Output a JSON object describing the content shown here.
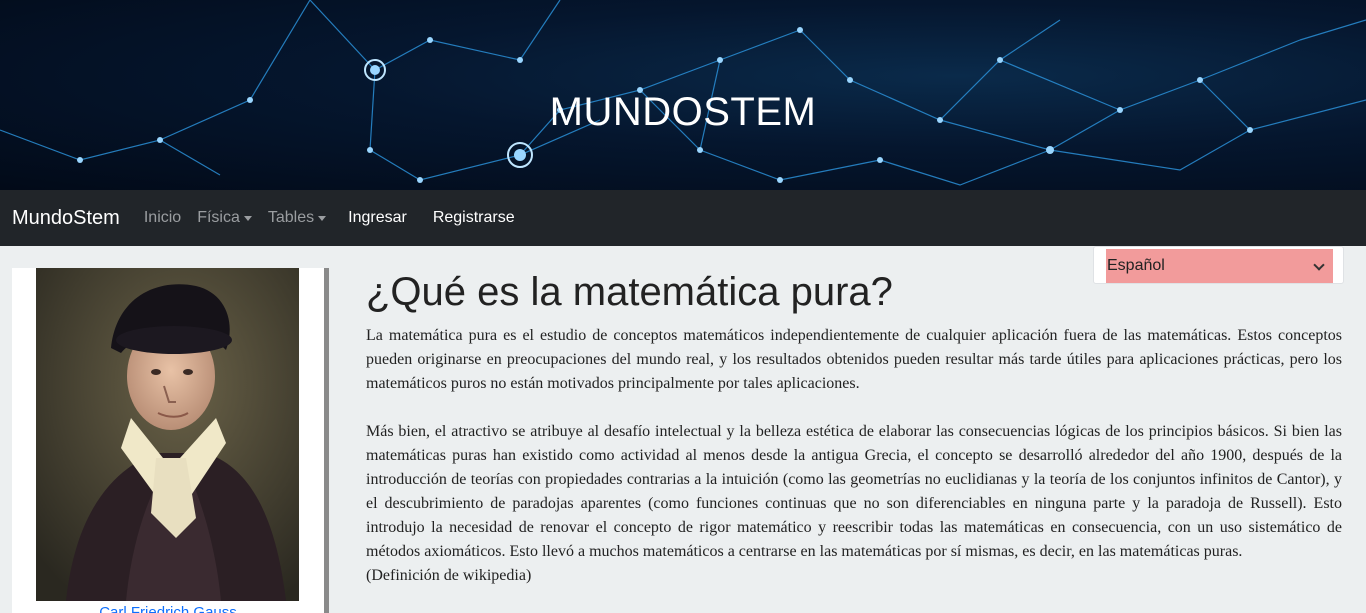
{
  "hero": {
    "title": "MUNDOSTEM"
  },
  "navbar": {
    "brand": "MundoStem",
    "items": [
      {
        "label": "Inicio"
      },
      {
        "label": "Física"
      },
      {
        "label": "Tables"
      }
    ],
    "login": "Ingresar",
    "register": "Registrarse"
  },
  "language_select": {
    "value": "Español",
    "color": "#f29b9b"
  },
  "sidebar": {
    "caption": "Carl Friedrich Gauss"
  },
  "main": {
    "title": "¿Qué es la matemática pura?",
    "paragraph1": "La matemática pura es el estudio de conceptos matemáticos independientemente de cualquier aplicación fuera de las matemáticas. Estos conceptos pueden originarse en preocupaciones del mundo real, y los resultados obtenidos pueden resultar más tarde útiles para aplicaciones prácticas, pero los matemáticos puros no están motivados principalmente por tales aplicaciones.",
    "paragraph2": "Más bien, el atractivo se atribuye al desafío intelectual y la belleza estética de elaborar las consecuencias lógicas de los principios básicos. Si bien las matemáticas puras han existido como actividad al menos desde la antigua Grecia, el concepto se desarrolló alrededor del año 1900, después de la introducción de teorías con propiedades contrarias a la intuición (como las geometrías no euclidianas y la teoría de los conjuntos infinitos de Cantor), y el descubrimiento de paradojas aparentes (como funciones continuas que no son diferenciables en ninguna parte y la paradoja de Russell). Esto introdujo la necesidad de renovar el concepto de rigor matemático y reescribir todas las matemáticas en consecuencia, con un uso sistemático de métodos axiomáticos. Esto llevó a muchos matemáticos a centrarse en las matemáticas por sí mismas, es decir, en las matemáticas puras.",
    "source": "(Definición de wikipedia)"
  }
}
